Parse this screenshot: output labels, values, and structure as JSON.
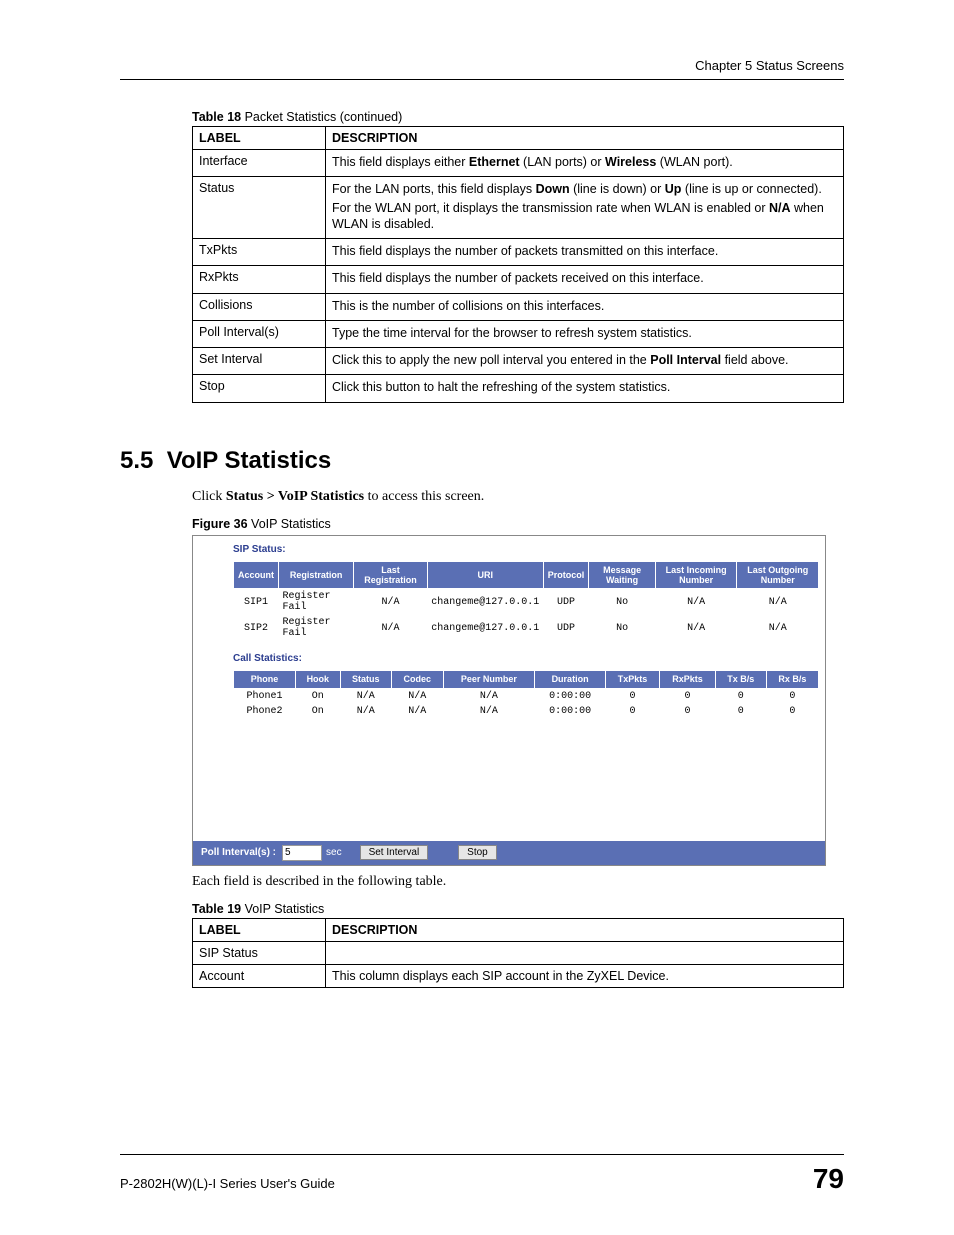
{
  "chapter_header": "Chapter 5 Status Screens",
  "table18": {
    "caption_bold": "Table 18",
    "caption_rest": "   Packet Statistics (continued)",
    "header": {
      "label": "LABEL",
      "desc": "DESCRIPTION"
    },
    "rows": [
      {
        "label": "Interface",
        "parts": [
          {
            "t": "This field displays either "
          },
          {
            "t": "Ethernet",
            "b": true
          },
          {
            "t": " (LAN ports) or "
          },
          {
            "t": "Wireless",
            "b": true
          },
          {
            "t": " (WLAN port)."
          }
        ]
      },
      {
        "label": "Status",
        "paras": [
          [
            {
              "t": "For the LAN ports, this field displays "
            },
            {
              "t": "Down",
              "b": true
            },
            {
              "t": " (line is down) or "
            },
            {
              "t": "Up",
              "b": true
            },
            {
              "t": " (line is up or connected)."
            }
          ],
          [
            {
              "t": "For the WLAN port, it displays the transmission rate when WLAN is enabled or "
            },
            {
              "t": "N/A",
              "b": true
            },
            {
              "t": " when WLAN is disabled."
            }
          ]
        ]
      },
      {
        "label": "TxPkts",
        "parts": [
          {
            "t": "This field displays the number of packets transmitted on this interface."
          }
        ]
      },
      {
        "label": "RxPkts",
        "parts": [
          {
            "t": "This field displays the number of packets received on this interface."
          }
        ]
      },
      {
        "label": "Collisions",
        "parts": [
          {
            "t": "This is the number of collisions on this interfaces."
          }
        ]
      },
      {
        "label": "Poll Interval(s)",
        "parts": [
          {
            "t": "Type the time interval for the browser to refresh system statistics."
          }
        ]
      },
      {
        "label": "Set Interval",
        "parts": [
          {
            "t": "Click this to apply the new poll interval you entered in the "
          },
          {
            "t": "Poll Interval",
            "b": true
          },
          {
            "t": " field above."
          }
        ]
      },
      {
        "label": "Stop",
        "parts": [
          {
            "t": "Click this button to halt the refreshing of the system statistics."
          }
        ]
      }
    ]
  },
  "section": {
    "number": "5.5",
    "title": "VoIP Statistics"
  },
  "intro": {
    "pre": "Click ",
    "bold": "Status > VoIP Statistics",
    "post": " to access this screen."
  },
  "figure36": {
    "caption_bold": "Figure 36",
    "caption_rest": "   VoIP Statistics",
    "sip_title": "SIP Status:",
    "sip_headers": [
      "Account",
      "Registration",
      "Last Registration",
      "URI",
      "Protocol",
      "Message Waiting",
      "Last Incoming Number",
      "Last Outgoing Number"
    ],
    "sip_rows": [
      {
        "account": "SIP1",
        "reg": "Register Fail",
        "last": "N/A",
        "uri": "changeme@127.0.0.1",
        "proto": "UDP",
        "msg": "No",
        "in": "N/A",
        "out": "N/A"
      },
      {
        "account": "SIP2",
        "reg": "Register Fail",
        "last": "N/A",
        "uri": "changeme@127.0.0.1",
        "proto": "UDP",
        "msg": "No",
        "in": "N/A",
        "out": "N/A"
      }
    ],
    "call_title": "Call Statistics:",
    "call_headers": [
      "Phone",
      "Hook",
      "Status",
      "Codec",
      "Peer Number",
      "Duration",
      "TxPkts",
      "RxPkts",
      "Tx B/s",
      "Rx B/s"
    ],
    "call_rows": [
      {
        "phone": "Phone1",
        "hook": "On",
        "status": "N/A",
        "codec": "N/A",
        "peer": "N/A",
        "dur": "0:00:00",
        "tx": "0",
        "rx": "0",
        "txb": "0",
        "rxb": "0"
      },
      {
        "phone": "Phone2",
        "hook": "On",
        "status": "N/A",
        "codec": "N/A",
        "peer": "N/A",
        "dur": "0:00:00",
        "tx": "0",
        "rx": "0",
        "txb": "0",
        "rxb": "0"
      }
    ],
    "poll_label": "Poll Interval(s) :",
    "poll_value": "5",
    "poll_sec": "sec",
    "set_interval": "Set Interval",
    "stop": "Stop"
  },
  "after_figure": "Each field is described in the following table.",
  "table19": {
    "caption_bold": "Table 19",
    "caption_rest": "   VoIP Statistics",
    "header": {
      "label": "LABEL",
      "desc": "DESCRIPTION"
    },
    "rows": [
      {
        "label": "SIP Status",
        "desc": ""
      },
      {
        "label": "Account",
        "desc": "This column displays each SIP account in the ZyXEL Device."
      }
    ]
  },
  "footer": {
    "left": "P-2802H(W)(L)-I Series User's Guide",
    "right": "79"
  }
}
